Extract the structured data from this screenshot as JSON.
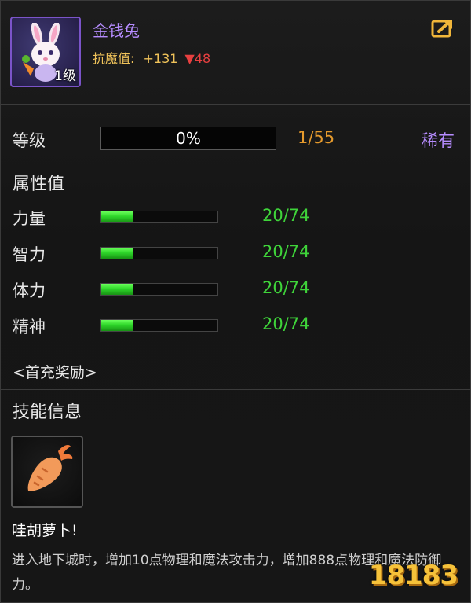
{
  "pet": {
    "name": "金钱兔",
    "level_badge": "1级",
    "resist_label": "抗魔值:",
    "resist_value": "+131",
    "resist_change": "▼48"
  },
  "level": {
    "label": "等级",
    "progress_text": "0%",
    "progress": 0,
    "count": "1/55",
    "rarity": "稀有"
  },
  "attributes": {
    "title": "属性值",
    "items": [
      {
        "label": "力量",
        "value": "20/74",
        "fraction": 0.27
      },
      {
        "label": "智力",
        "value": "20/74",
        "fraction": 0.27
      },
      {
        "label": "体力",
        "value": "20/74",
        "fraction": 0.27
      },
      {
        "label": "精神",
        "value": "20/74",
        "fraction": 0.27
      }
    ]
  },
  "reward_link": "<首充奖励>",
  "skill": {
    "section_title": "技能信息",
    "icon": "carrot-icon",
    "name": "哇胡萝卜!",
    "description": "进入地下城时，增加10点物理和魔法攻击力，增加888点物理和魔法防御力。"
  },
  "watermark": "18183",
  "icons": {
    "share": "share-arrow-icon"
  },
  "colors": {
    "name": "#b68cff",
    "gold": "#f0c35a",
    "red": "#e84040",
    "green": "#3fd43a",
    "orange": "#e59a2d"
  }
}
